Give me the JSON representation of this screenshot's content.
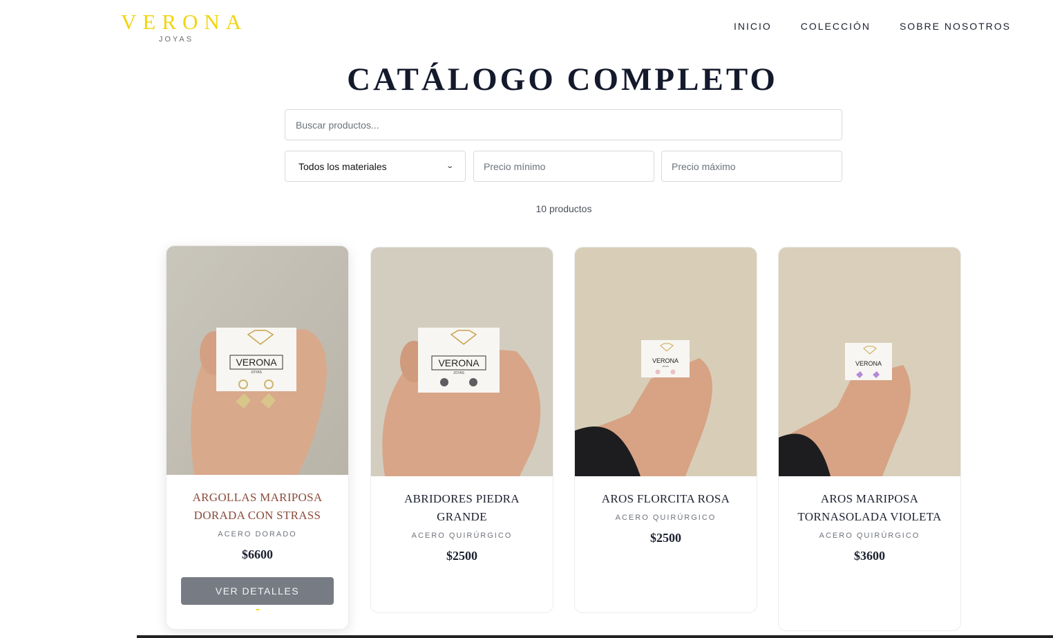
{
  "header": {
    "logo_main": "VERONA",
    "logo_sub": "JOYAS",
    "nav": [
      "INICIO",
      "COLECCIÓN",
      "SOBRE NOSOTROS"
    ]
  },
  "page_title": "CATÁLOGO COMPLETO",
  "filters": {
    "search_placeholder": "Buscar productos...",
    "material_selected": "Todos los materiales",
    "price_min_placeholder": "Precio mínimo",
    "price_max_placeholder": "Precio máximo"
  },
  "product_count": "10 productos",
  "products": [
    {
      "name": "ARGOLLAS MARIPOSA DORADA CON STRASS",
      "material": "ACERO DORADO",
      "price": "$6600",
      "button": "VER DETALLES",
      "card_text": "VERONA",
      "card_sub": "JOYAS"
    },
    {
      "name": "ABRIDORES PIEDRA GRANDE",
      "material": "ACERO QUIRÚRGICO",
      "price": "$2500",
      "card_text": "VERONA",
      "card_sub": "JOYAS"
    },
    {
      "name": "AROS FLORCITA ROSA",
      "material": "ACERO QUIRÚRGICO",
      "price": "$2500",
      "card_text": "VERONA",
      "card_sub": "JOYAS"
    },
    {
      "name": "AROS MARIPOSA TORNASOLADA VIOLETA",
      "material": "ACERO QUIRÚRGICO",
      "price": "$3600",
      "card_text": "VERONA",
      "card_sub": ""
    }
  ],
  "colors": {
    "brand_gold": "#f2d410",
    "button_gray": "#777b84",
    "title_navy": "#141a2c"
  }
}
